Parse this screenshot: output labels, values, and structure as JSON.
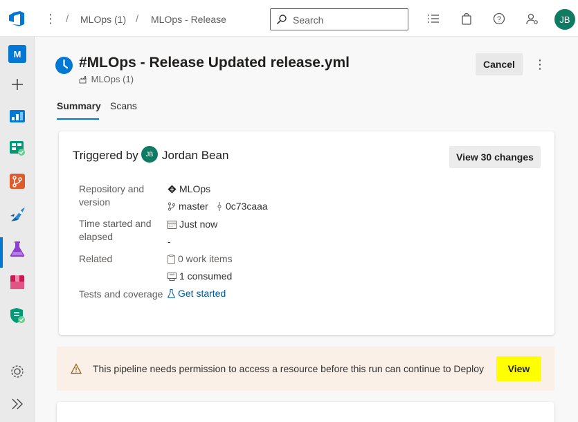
{
  "topbar": {
    "org_icon": "azure-devops-logo-icon",
    "more_icon": "more-vertical-icon",
    "breadcrumb": [
      "MLOps (1)",
      "MLOps - Release"
    ],
    "search_placeholder": "Search",
    "icons": [
      "task-list-icon",
      "shopping-bag-icon",
      "help-icon",
      "user-settings-icon"
    ],
    "avatar": "JB"
  },
  "rail": {
    "items": [
      {
        "name": "project-m-icon",
        "label": "M"
      },
      {
        "name": "add-icon"
      },
      {
        "name": "overview-icon"
      },
      {
        "name": "boards-icon"
      },
      {
        "name": "repos-icon"
      },
      {
        "name": "pipelines-icon",
        "active": true
      },
      {
        "name": "test-plans-icon"
      },
      {
        "name": "artifacts-icon"
      },
      {
        "name": "security-icon"
      },
      {
        "name": "settings-icon"
      },
      {
        "name": "collapse-icon"
      }
    ]
  },
  "run": {
    "title": "#MLOps - Release Updated release.yml",
    "subtitle": "MLOps (1)",
    "cancel_label": "Cancel"
  },
  "tabs": [
    {
      "label": "Summary",
      "active": true
    },
    {
      "label": "Scans",
      "active": false
    }
  ],
  "summary": {
    "triggered_by_label": "Triggered by",
    "trigger_avatar": "JB",
    "trigger_name": "Jordan Bean",
    "changes_button": "View 30 changes",
    "rows": {
      "repo_label": "Repository and version",
      "repo_name": "MLOps",
      "branch": "master",
      "commit": "0c73caaa",
      "time_label": "Time started and elapsed",
      "started": "Just now",
      "elapsed": "-",
      "related_label": "Related",
      "work_items": "0 work items",
      "consumed": "1 consumed",
      "tests_label": "Tests and coverage",
      "tests_link": "Get started"
    }
  },
  "warning": {
    "text": "This pipeline needs permission to access a resource before this run can continue to Deploy",
    "button": "View",
    "highlight": "#ffff00"
  },
  "colors": {
    "accent": "#0078d4",
    "avatar": "#0f7b63"
  }
}
